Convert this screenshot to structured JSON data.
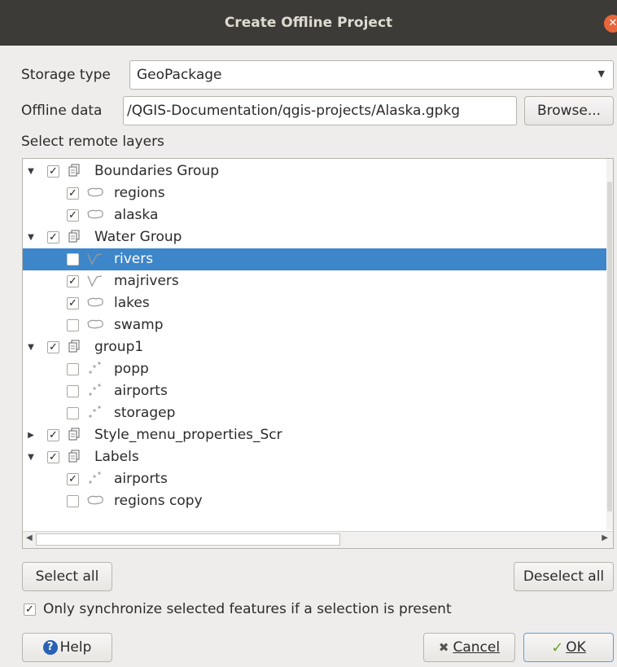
{
  "window": {
    "title": "Create Offline Project"
  },
  "storage": {
    "label": "Storage type",
    "value": "GeoPackage"
  },
  "offline_data": {
    "label": "Offline data",
    "value": "\u0000/QGIS-Documentation/qgis-projects/Alaska.gpkg",
    "browse_label": "Browse..."
  },
  "layers_label": "Select remote layers",
  "tree": [
    {
      "label": "Boundaries Group",
      "type": "group",
      "expanded": true,
      "checked": true,
      "level": 0,
      "icon": "group-icon"
    },
    {
      "label": "regions",
      "type": "polygon",
      "checked": true,
      "level": 1,
      "icon": "polygon-layer-icon"
    },
    {
      "label": "alaska",
      "type": "polygon",
      "checked": true,
      "level": 1,
      "icon": "polygon-layer-icon"
    },
    {
      "label": "Water Group",
      "type": "group",
      "expanded": true,
      "checked": true,
      "level": 0,
      "icon": "group-icon"
    },
    {
      "label": "rivers",
      "type": "line",
      "checked": false,
      "level": 1,
      "icon": "line-layer-icon",
      "selected": true
    },
    {
      "label": "majrivers",
      "type": "line",
      "checked": true,
      "level": 1,
      "icon": "line-layer-icon"
    },
    {
      "label": "lakes",
      "type": "polygon",
      "checked": true,
      "level": 1,
      "icon": "polygon-layer-icon"
    },
    {
      "label": "swamp",
      "type": "polygon",
      "checked": false,
      "level": 1,
      "icon": "polygon-layer-icon"
    },
    {
      "label": "group1",
      "type": "group",
      "expanded": true,
      "checked": true,
      "level": 0,
      "icon": "group-icon"
    },
    {
      "label": "popp",
      "type": "point",
      "checked": false,
      "level": 1,
      "icon": "point-layer-icon"
    },
    {
      "label": "airports",
      "type": "point",
      "checked": false,
      "level": 1,
      "icon": "point-layer-icon"
    },
    {
      "label": "storagep",
      "type": "point",
      "checked": false,
      "level": 1,
      "icon": "point-layer-icon"
    },
    {
      "label": "Style_menu_properties_Scr",
      "type": "group",
      "expanded": false,
      "checked": true,
      "level": 0,
      "icon": "group-icon"
    },
    {
      "label": "Labels",
      "type": "group",
      "expanded": true,
      "checked": true,
      "level": 0,
      "icon": "group-icon"
    },
    {
      "label": "airports",
      "type": "point",
      "checked": true,
      "level": 1,
      "icon": "point-layer-icon"
    },
    {
      "label": "regions copy",
      "type": "polygon",
      "checked": false,
      "level": 1,
      "icon": "polygon-layer-icon"
    }
  ],
  "buttons": {
    "select_all": "Select all",
    "deselect_all": "Deselect all",
    "help": "Help",
    "cancel": "Cancel",
    "ok": "OK"
  },
  "only_selected": {
    "label": "Only synchronize selected features if a selection is present",
    "checked": true
  },
  "colors": {
    "selection": "#3d86c9",
    "titlebar": "#3c3b37",
    "close": "#e9663a"
  }
}
